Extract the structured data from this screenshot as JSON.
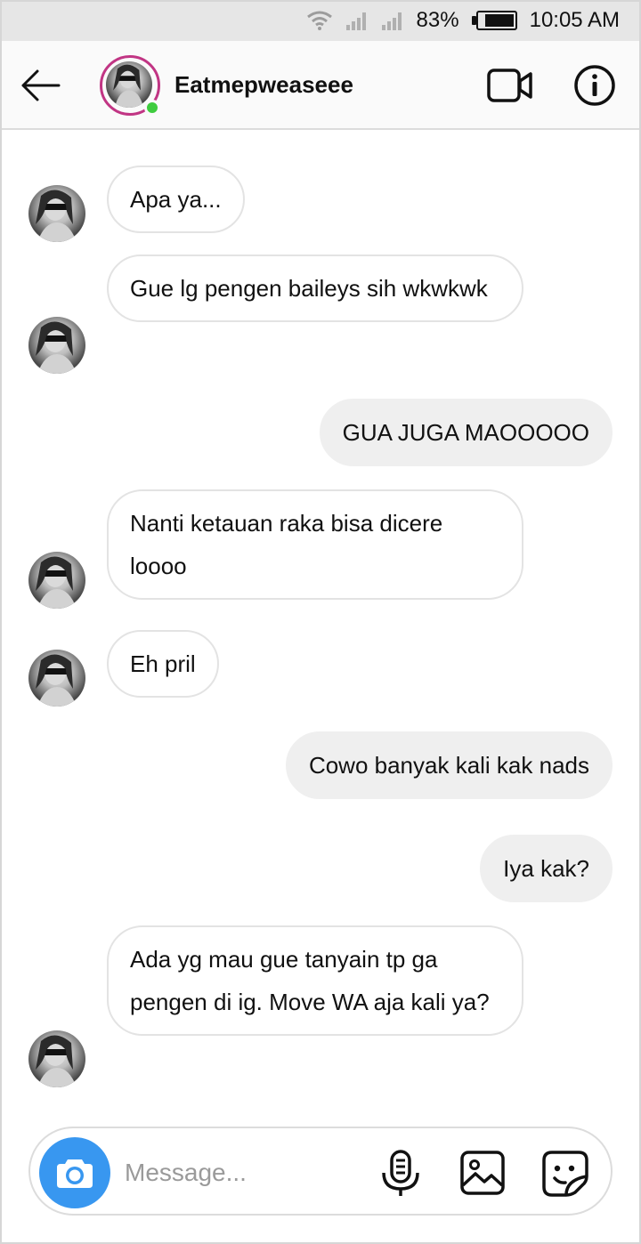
{
  "status_bar": {
    "battery": "83%",
    "time": "10:05 AM"
  },
  "header": {
    "username": "Eatmepweaseee"
  },
  "messages": [
    {
      "side": "in",
      "text": "Apa ya..."
    },
    {
      "side": "in",
      "text": "Gue lg pengen baileys sih wkwkwk"
    },
    {
      "side": "out",
      "text": "GUA JUGA MAOOOOO"
    },
    {
      "side": "in",
      "text": "Nanti ketauan raka bisa dicere loooo"
    },
    {
      "side": "in",
      "text": "Eh pril"
    },
    {
      "side": "out",
      "text": "Cowo banyak kali kak nads"
    },
    {
      "side": "out",
      "text": "Iya kak?"
    },
    {
      "side": "in",
      "text": "Ada yg mau gue tanyain tp ga pengen di ig. Move WA aja kali ya?"
    }
  ],
  "composer": {
    "placeholder": "Message..."
  },
  "colors": {
    "accent": "#3897f0",
    "story_ring": "#c13584",
    "online": "#3fcc3f"
  },
  "icons": [
    "wifi-icon",
    "signal-icon",
    "battery-icon",
    "back-arrow-icon",
    "video-call-icon",
    "info-icon",
    "camera-icon",
    "microphone-icon",
    "gallery-icon",
    "sticker-icon"
  ]
}
